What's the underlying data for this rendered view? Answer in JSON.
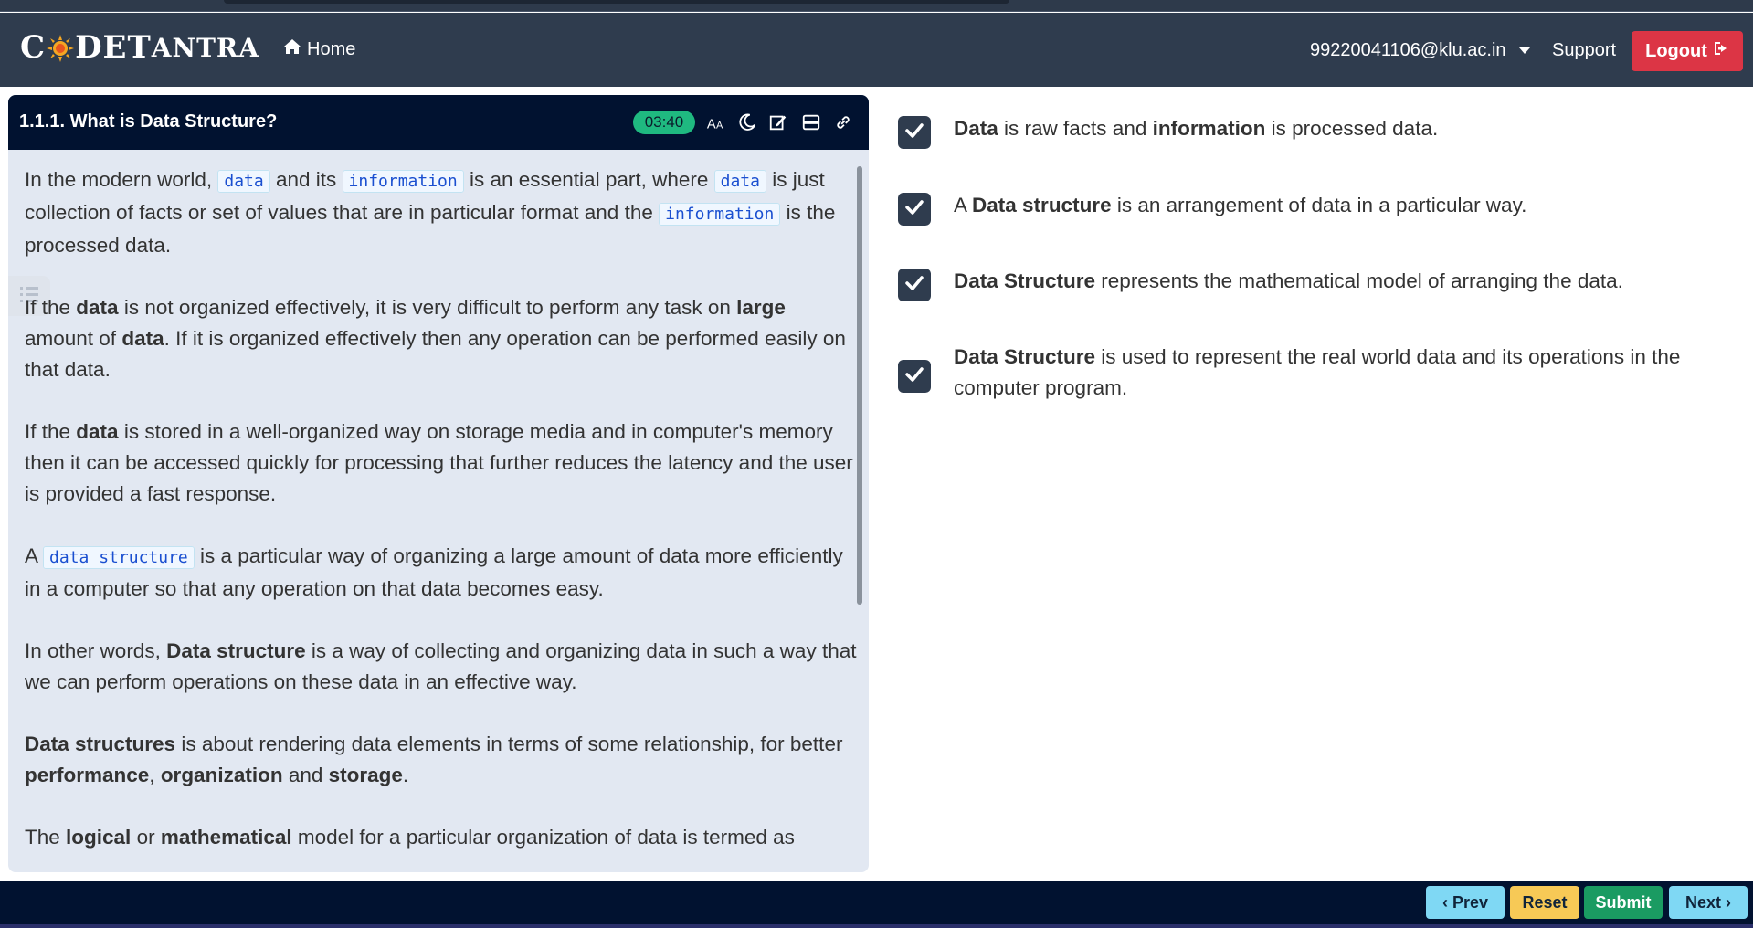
{
  "brand": {
    "part1": "C",
    "part2": "DE",
    "part3": "T",
    "part4": "ANTRA"
  },
  "nav": {
    "home_label": "Home",
    "user_email": "99220041106@klu.ac.in",
    "support_label": "Support",
    "logout_label": "Logout"
  },
  "lesson": {
    "title": "1.1.1. What is Data Structure?",
    "timer": "03:40",
    "icons": [
      "text-size-icon",
      "dark-mode-icon",
      "edit-icon",
      "layout-icon",
      "link-icon"
    ],
    "paragraphs": {
      "p1": {
        "t1": "In the modern world, ",
        "c1": "data",
        "t2": " and its ",
        "c2": "information",
        "t3": " is an essential part, where ",
        "c3": "data",
        "t4": " is just collection of facts or set of values that are in particular format and the ",
        "c4": "information",
        "t5": " is the processed data."
      },
      "p2": {
        "t1": "If the ",
        "b1": "data",
        "t2": " is not organized effectively, it is very difficult to perform any task on ",
        "b2": "large",
        "t3": " amount of ",
        "b3": "data",
        "t4": ". If it is organized effectively then any operation can be performed easily on that data."
      },
      "p3": {
        "t1": "If the ",
        "b1": "data",
        "t2": " is stored in a well-organized way on storage media and in computer's memory then it can be accessed quickly for processing that further reduces the latency and the user is provided a fast response."
      },
      "p4": {
        "t1": "A ",
        "c1": "data structure",
        "t2": " is a particular way of organizing a large amount of data more efficiently in a computer so that any operation on that data becomes easy."
      },
      "p5": {
        "t1": "In other words, ",
        "b1": "Data structure",
        "t2": " is a way of collecting and organizing data in such a way that we can perform operations on these data in an effective way."
      },
      "p6": {
        "b1": "Data structures",
        "t1": " is about rendering data elements in terms of some relationship, for better ",
        "b2": "performance",
        "t2": ", ",
        "b3": "organization",
        "t3": " and ",
        "b4": "storage",
        "t4": "."
      },
      "p7": {
        "t1": "The ",
        "b1": "logical",
        "t2": " or ",
        "b2": "mathematical",
        "t3": " model for a particular organization of data is termed as"
      }
    }
  },
  "checklist": [
    {
      "b1": "Data",
      "t1": " is raw facts and ",
      "b2": "information",
      "t2": " is processed data.",
      "checked": true
    },
    {
      "t0": "A ",
      "b1": "Data structure",
      "t1": " is an arrangement of data in a particular way.",
      "checked": true
    },
    {
      "b1": "Data Structure",
      "t1": " represents the mathematical model of arranging the data.",
      "checked": true
    },
    {
      "b1": "Data Structure",
      "t1": " is used to represent the real world data and its operations in the computer program.",
      "checked": true
    }
  ],
  "actions": {
    "prev_label": "Prev",
    "reset_label": "Reset",
    "submit_label": "Submit",
    "next_label": "Next"
  },
  "colors": {
    "navbar": "#2f3c4e",
    "header_dark": "#011230",
    "panel_bg": "#e2e8f2",
    "timer": "#1fb980",
    "logout": "#dc3545",
    "prev_next": "#7fd8f4",
    "reset": "#f7c956",
    "submit": "#1a9b62"
  }
}
